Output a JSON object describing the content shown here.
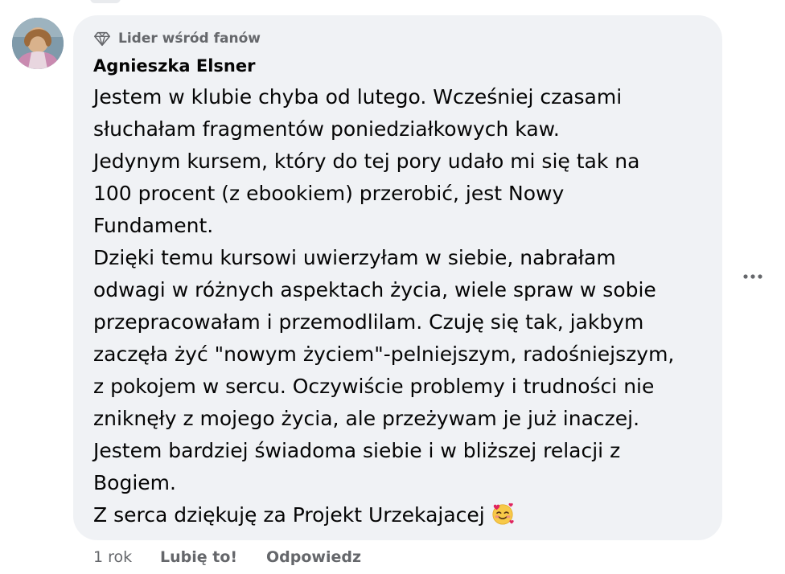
{
  "comment": {
    "badge_label": "Lider wśród fanów",
    "author": "Agnieszka Elsner",
    "text_lines": [
      "Jestem w klubie chyba od lutego. Wcześniej czasami",
      "słuchałam fragmentów poniedziałkowych kaw.",
      "Jedynym kursem, który do tej pory udało mi się tak na",
      "100 procent (z ebookiem) przerobić, jest Nowy",
      "Fundament.",
      "Dzięki temu kursowi uwierzyłam w siebie, nabrałam",
      "odwagi w różnych aspektach życia, wiele spraw w sobie",
      "przepracowałam i przemodlilam. Czuję się tak, jakbym",
      "zaczęła żyć \"nowym życiem\"-pelniejszym, radośniejszym,",
      "z pokojem w sercu. Oczywiście problemy i trudności nie",
      "zniknęły z mojego życia, ale przeżywam je już inaczej.",
      "Jestem bardziej świadoma siebie i w bliższej relacji z",
      "Bogiem.",
      "Z serca dziękuję za Projekt Urzekajacej"
    ],
    "emoji": "smiling-face-with-hearts"
  },
  "actions": {
    "time": "1 rok",
    "like_label": "Lubię to!",
    "reply_label": "Odpowiedz"
  },
  "colors": {
    "bubble": "#f0f2f5",
    "secondary_text": "#65676b",
    "primary_text": "#050505"
  },
  "icons": {
    "badge": "diamond-icon",
    "menu": "more-options-icon"
  }
}
